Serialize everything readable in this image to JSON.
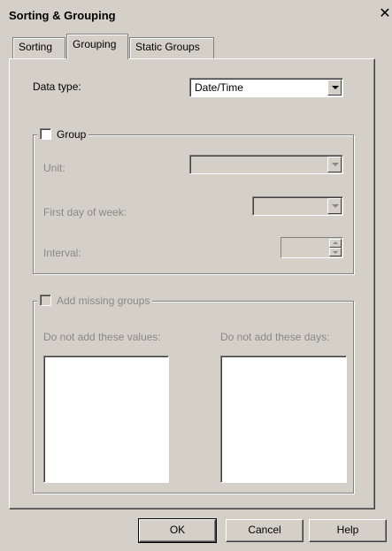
{
  "window": {
    "title": "Sorting & Grouping",
    "close_symbol": "✕"
  },
  "tabs": [
    {
      "label": "Sorting",
      "active": false
    },
    {
      "label": "Grouping",
      "active": true
    },
    {
      "label": "Static Groups",
      "active": false
    }
  ],
  "grouping": {
    "data_type_label": "Data type:",
    "data_type_value": "Date/Time",
    "group_checkbox_label": "Group",
    "unit_label": "Unit:",
    "unit_value": "",
    "first_day_label": "First day of week:",
    "first_day_value": "",
    "interval_label": "Interval:",
    "interval_value": ""
  },
  "missing": {
    "checkbox_label": "Add missing groups",
    "values_label": "Do not add these values:",
    "days_label": "Do not add these days:"
  },
  "buttons": {
    "ok": "OK",
    "cancel": "Cancel",
    "help": "Help"
  }
}
